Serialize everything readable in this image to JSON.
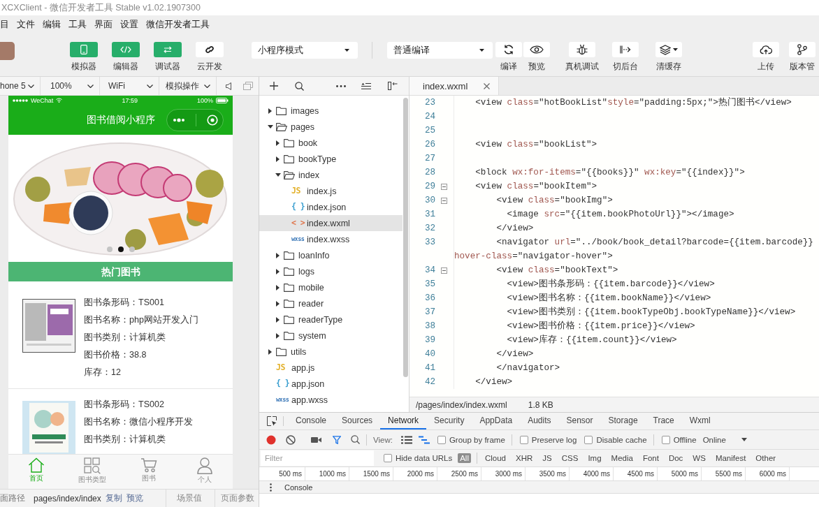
{
  "window": {
    "title": "XCXClient - 微信开发者工具 Stable v1.02.1907300"
  },
  "menu": [
    "目",
    "文件",
    "编辑",
    "工具",
    "界面",
    "设置",
    "微信开发者工具"
  ],
  "toolbar": {
    "panel_toggles": [
      {
        "label": "模拟器",
        "on": true
      },
      {
        "label": "编辑器",
        "on": true
      },
      {
        "label": "调试器",
        "on": true
      }
    ],
    "cloud_button": "云开发",
    "mode_select": "小程序模式",
    "compile_select": "普通编译",
    "action_groups": [
      [
        "编译",
        "预览"
      ],
      [
        "真机调试",
        "切后台",
        "清缓存"
      ],
      [
        "上传",
        "版本管"
      ]
    ]
  },
  "simulator": {
    "toolbar": {
      "device": "hone 5",
      "zoom": "100%",
      "network": "WiFi",
      "operation": "模拟操作"
    },
    "phone": {
      "status_bar": {
        "carrier": "WeChat",
        "time": "17:59",
        "battery": "100%"
      },
      "title": "图书借阅小程序",
      "carousel_dots": [
        {
          "selected": false
        },
        {
          "selected": true
        },
        {
          "selected": false
        }
      ],
      "section_title": "热门图书",
      "books": [
        {
          "fields": [
            "图书条形码：TS001",
            "图书名称：php网站开发入门",
            "图书类别：计算机类",
            "图书价格：38.8",
            "库存：12"
          ]
        },
        {
          "fields": [
            "图书条形码：TS002",
            "图书名称：微信小程序开发",
            "图书类别：计算机类"
          ]
        }
      ],
      "tab_bar": [
        {
          "label": "首页",
          "selected": true
        },
        {
          "label": "图书类型",
          "selected": false
        },
        {
          "label": "图书",
          "selected": false
        },
        {
          "label": "个人",
          "selected": false
        }
      ]
    },
    "status_bar": {
      "path_label": "面路径",
      "path": "pages/index/index",
      "actions": [
        "复制",
        "预览"
      ],
      "scene": "场景值",
      "params": "页面参数"
    }
  },
  "file_tree": [
    {
      "name": "images",
      "kind": "folder",
      "expanded": false,
      "selected": false
    },
    {
      "name": "pages",
      "kind": "folder",
      "expanded": true,
      "selected": false,
      "children": [
        {
          "name": "book",
          "kind": "folder",
          "expanded": false,
          "selected": false
        },
        {
          "name": "bookType",
          "kind": "folder",
          "expanded": false,
          "selected": false
        },
        {
          "name": "index",
          "kind": "folder",
          "expanded": true,
          "selected": false,
          "children": [
            {
              "name": "index.js",
              "kind": "file",
              "badge": "JS",
              "color": "#e3b12b",
              "selected": false
            },
            {
              "name": "index.json",
              "kind": "file",
              "badge": "{ }",
              "color": "#3a9fd0",
              "selected": false
            },
            {
              "name": "index.wxml",
              "kind": "file",
              "badge": "< >",
              "color": "#e0784f",
              "selected": true
            },
            {
              "name": "index.wxss",
              "kind": "file",
              "badge": "wxss",
              "color": "#3b78b8",
              "selected": false
            }
          ]
        },
        {
          "name": "loanInfo",
          "kind": "folder",
          "expanded": false,
          "selected": false
        },
        {
          "name": "logs",
          "kind": "folder",
          "expanded": false,
          "selected": false
        },
        {
          "name": "mobile",
          "kind": "folder",
          "expanded": false,
          "selected": false
        },
        {
          "name": "reader",
          "kind": "folder",
          "expanded": false,
          "selected": false
        },
        {
          "name": "readerType",
          "kind": "folder",
          "expanded": false,
          "selected": false
        },
        {
          "name": "system",
          "kind": "folder",
          "expanded": false,
          "selected": false
        }
      ]
    },
    {
      "name": "utils",
      "kind": "folder",
      "expanded": false,
      "selected": false
    },
    {
      "name": "app.js",
      "kind": "file",
      "badge": "JS",
      "color": "#e3b12b",
      "selected": false
    },
    {
      "name": "app.json",
      "kind": "file",
      "badge": "{ }",
      "color": "#3a9fd0",
      "selected": false
    },
    {
      "name": "app.wxss",
      "kind": "file",
      "badge": "wxss",
      "color": "#3b78b8",
      "selected": false
    }
  ],
  "editor": {
    "tabs": [
      {
        "label": "index.wxml",
        "selected": true
      }
    ],
    "lines": [
      {
        "number": "23",
        "foldable": false,
        "tokens": [
          {
            "kind": "plain",
            "text": "    <view "
          },
          {
            "kind": "attr",
            "text": "class"
          },
          {
            "kind": "plain",
            "text": "=\"hotBookList\""
          },
          {
            "kind": "attr",
            "text": "style"
          },
          {
            "kind": "plain",
            "text": "=\"padding:5px;\">热门图书</view>"
          }
        ]
      },
      {
        "number": "24",
        "foldable": false
      },
      {
        "number": "25",
        "foldable": false
      },
      {
        "number": "26",
        "foldable": false,
        "tokens": [
          {
            "kind": "plain",
            "text": "    <view "
          },
          {
            "kind": "attr",
            "text": "class"
          },
          {
            "kind": "plain",
            "text": "=\"bookList\">"
          }
        ]
      },
      {
        "number": "27",
        "foldable": false
      },
      {
        "number": "28",
        "foldable": false,
        "tokens": [
          {
            "kind": "plain",
            "text": "    <block "
          },
          {
            "kind": "attr",
            "text": "wx:for-items"
          },
          {
            "kind": "plain",
            "text": "=\"{{books}}\" "
          },
          {
            "kind": "attr",
            "text": "wx:key"
          },
          {
            "kind": "plain",
            "text": "=\"{{index}}\">"
          }
        ]
      },
      {
        "number": "29",
        "foldable": true,
        "tokens": [
          {
            "kind": "plain",
            "text": "    <view "
          },
          {
            "kind": "attr",
            "text": "class"
          },
          {
            "kind": "plain",
            "text": "=\"bookItem\">"
          }
        ]
      },
      {
        "number": "30",
        "foldable": true,
        "tokens": [
          {
            "kind": "plain",
            "text": "        <view "
          },
          {
            "kind": "attr",
            "text": "class"
          },
          {
            "kind": "plain",
            "text": "=\"bookImg\">"
          }
        ]
      },
      {
        "number": "31",
        "foldable": false,
        "tokens": [
          {
            "kind": "plain",
            "text": "          <image "
          },
          {
            "kind": "attr",
            "text": "src"
          },
          {
            "kind": "plain",
            "text": "=\"{{item.bookPhotoUrl}}\"></image>"
          }
        ]
      },
      {
        "number": "32",
        "foldable": false,
        "tokens": [
          {
            "kind": "plain",
            "text": "        </view>"
          }
        ]
      },
      {
        "number": "33",
        "foldable": false,
        "tokens": [
          {
            "kind": "plain",
            "text": "        <navigator "
          },
          {
            "kind": "attr",
            "text": "url"
          },
          {
            "kind": "plain",
            "text": "=\"../book/book_detail?barcode={{item.barcode}}"
          }
        ],
        "continuation": [
          {
            "kind": "attr",
            "text": "hover-class"
          },
          {
            "kind": "plain",
            "text": "=\"navigator-hover\">"
          }
        ]
      },
      {
        "number": "34",
        "foldable": true,
        "tokens": [
          {
            "kind": "plain",
            "text": "        <view "
          },
          {
            "kind": "attr",
            "text": "class"
          },
          {
            "kind": "plain",
            "text": "=\"bookText\">"
          }
        ]
      },
      {
        "number": "35",
        "foldable": false,
        "tokens": [
          {
            "kind": "plain",
            "text": "          <view>图书条形码：{{item.barcode}}</view>"
          }
        ]
      },
      {
        "number": "36",
        "foldable": false,
        "tokens": [
          {
            "kind": "plain",
            "text": "          <view>图书名称：{{item.bookName}}</view>"
          }
        ]
      },
      {
        "number": "37",
        "foldable": false,
        "tokens": [
          {
            "kind": "plain",
            "text": "          <view>图书类别：{{item.bookTypeObj.bookTypeName}}</view>"
          }
        ]
      },
      {
        "number": "38",
        "foldable": false,
        "tokens": [
          {
            "kind": "plain",
            "text": "          <view>图书价格：{{item.price}}</view>"
          }
        ]
      },
      {
        "number": "39",
        "foldable": false,
        "tokens": [
          {
            "kind": "plain",
            "text": "          <view>库存：{{item.count}}</view>"
          }
        ]
      },
      {
        "number": "40",
        "foldable": false,
        "tokens": [
          {
            "kind": "plain",
            "text": "        </view>"
          }
        ]
      },
      {
        "number": "41",
        "foldable": false,
        "tokens": [
          {
            "kind": "plain",
            "text": "        </navigator>"
          }
        ]
      },
      {
        "number": "42",
        "foldable": false,
        "tokens": [
          {
            "kind": "plain",
            "text": "    </view>"
          }
        ]
      }
    ],
    "status_bar": {
      "path": "/pages/index/index.wxml",
      "size": "1.8 KB"
    }
  },
  "devtools": {
    "tabs": [
      {
        "label": "Console",
        "selected": false
      },
      {
        "label": "Sources",
        "selected": false
      },
      {
        "label": "Network",
        "selected": true
      },
      {
        "label": "Security",
        "selected": false
      },
      {
        "label": "AppData",
        "selected": false
      },
      {
        "label": "Audits",
        "selected": false
      },
      {
        "label": "Sensor",
        "selected": false
      },
      {
        "label": "Storage",
        "selected": false
      },
      {
        "label": "Trace",
        "selected": false
      },
      {
        "label": "Wxml",
        "selected": false
      }
    ],
    "recording": true,
    "view_label": "View:",
    "view_modes": [
      {
        "selected": false
      },
      {
        "selected": true
      }
    ],
    "option_groups": [
      [
        {
          "label": "Group by frame",
          "checked": false
        }
      ],
      [
        {
          "label": "Preserve log",
          "checked": false
        },
        {
          "label": "Disable cache",
          "checked": false
        }
      ],
      [
        {
          "label": "Offline",
          "checked": false
        }
      ]
    ],
    "throttling": "Online",
    "filter": {
      "placeholder": "Filter"
    },
    "hide_data_urls": {
      "label": "Hide data URLs",
      "checked": false
    },
    "resource_types": [
      {
        "label": "All",
        "selected": true
      },
      {
        "label": "Cloud",
        "selected": false
      },
      {
        "label": "XHR",
        "selected": false
      },
      {
        "label": "JS",
        "selected": false
      },
      {
        "label": "CSS",
        "selected": false
      },
      {
        "label": "Img",
        "selected": false
      },
      {
        "label": "Media",
        "selected": false
      },
      {
        "label": "Font",
        "selected": false
      },
      {
        "label": "Doc",
        "selected": false
      },
      {
        "label": "WS",
        "selected": false
      },
      {
        "label": "Manifest",
        "selected": false
      },
      {
        "label": "Other",
        "selected": false
      }
    ],
    "timeline_ticks": [
      "500 ms",
      "1000 ms",
      "1500 ms",
      "2000 ms",
      "2500 ms",
      "3000 ms",
      "3500 ms",
      "4000 ms",
      "4500 ms",
      "5000 ms",
      "5500 ms",
      "6000 ms"
    ],
    "drawer_tab": "Console"
  }
}
